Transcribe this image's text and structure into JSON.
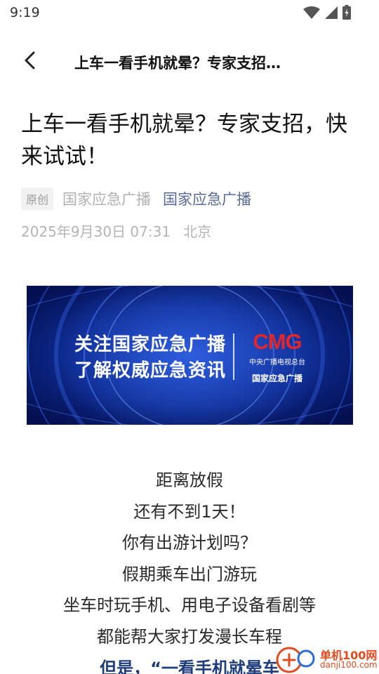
{
  "status_bar": {
    "time": "9:19"
  },
  "nav": {
    "title": "上车一看手机就晕？专家支招…"
  },
  "article": {
    "title": "上车一看手机就晕？专家支招，快来试试！",
    "tag": "原创",
    "source": "国家应急广播",
    "account": "国家应急广播",
    "date": "2025年9月30日 07:31",
    "location": "北京"
  },
  "banner": {
    "line1": "关注国家应急广播",
    "line2": "了解权威应急资讯",
    "logo": "CMG",
    "logo_sub": "中央广播电视总台",
    "brand": "国家应急广播"
  },
  "body_lines": [
    "距离放假",
    "还有不到1天！",
    "你有出游计划吗？",
    "假期乘车出门游玩",
    "坐车时玩手机、用电子设备看剧等",
    "都能帮大家打发漫长车程",
    "但是，“一看手机就晕车"
  ],
  "watermark": {
    "text": "单机100网",
    "url": "danji100.com"
  },
  "colors": {
    "account_link": "#576b95",
    "emphasis": "#1e3c7a",
    "cmg_red": "#e2262c"
  }
}
